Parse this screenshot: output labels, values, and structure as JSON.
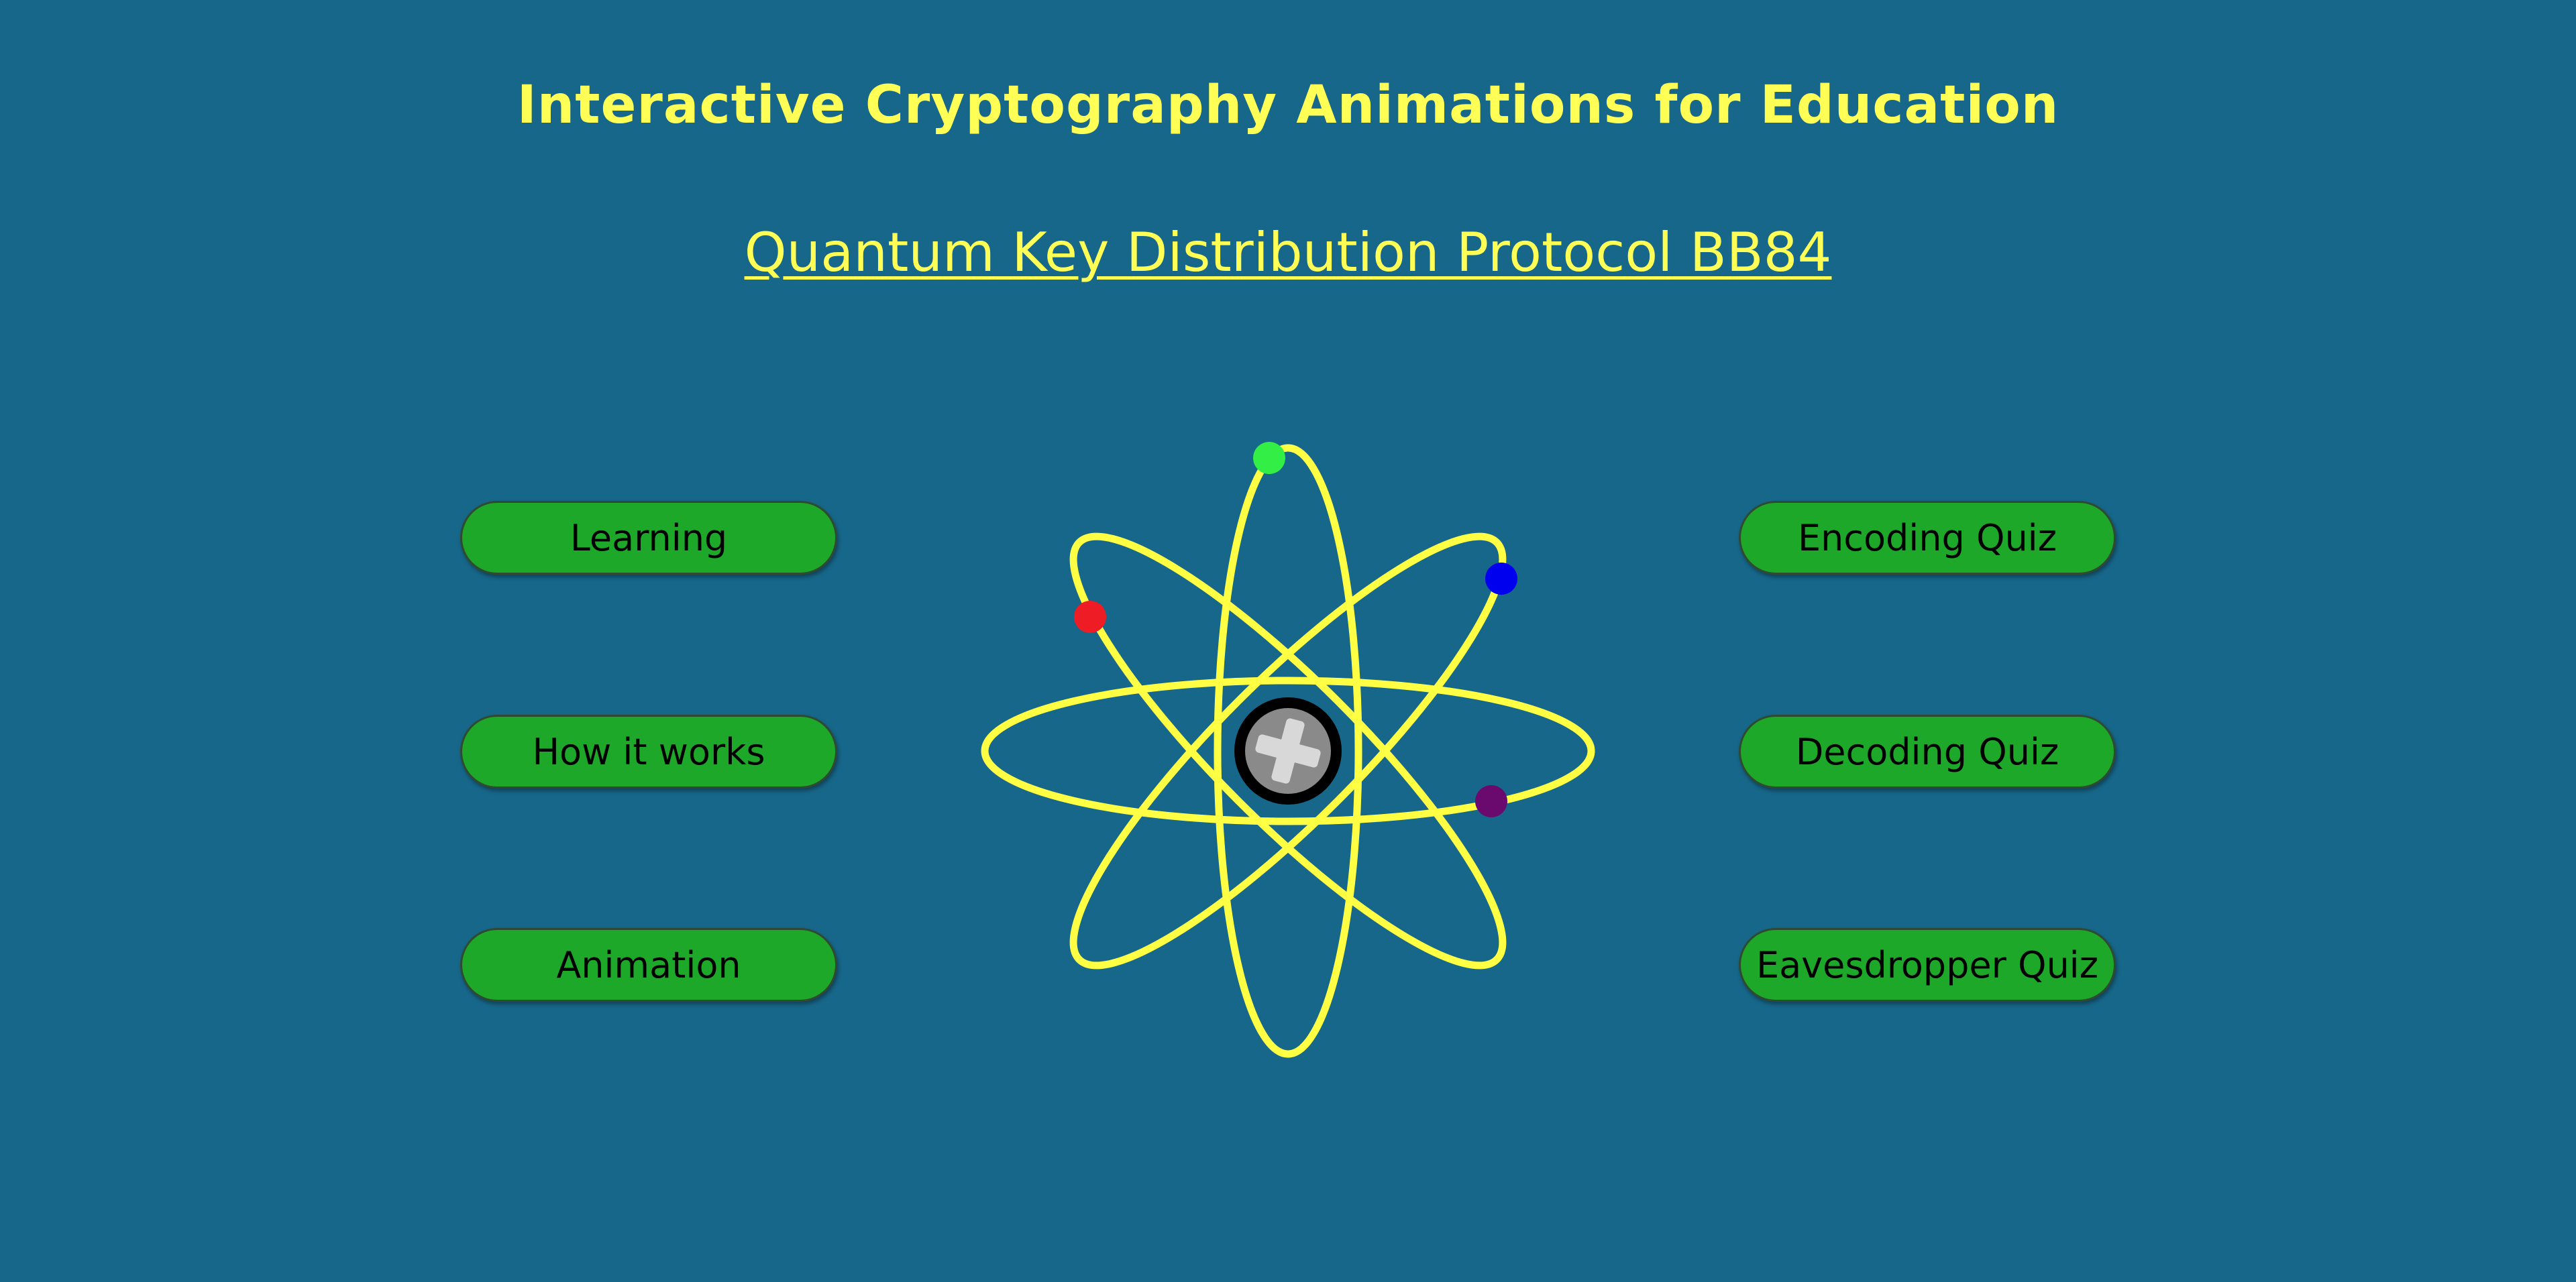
{
  "header": {
    "title": "Interactive Cryptography Animations for Education",
    "subtitle": "Quantum Key Distribution Protocol BB84"
  },
  "left_menu": [
    {
      "label": "Learning"
    },
    {
      "label": "How it works"
    },
    {
      "label": "Animation"
    }
  ],
  "right_menu": [
    {
      "label": "Encoding Quiz"
    },
    {
      "label": "Decoding Quiz"
    },
    {
      "label": "Eavesdropper Quiz"
    }
  ],
  "colors": {
    "background": "#17678a",
    "title_text": "#ffff55",
    "button_fill": "#1ea82a",
    "orbit": "#ffff44",
    "electron_green": "#33ee44",
    "electron_blue": "#0000ee",
    "electron_red": "#ee1c24",
    "electron_purple": "#6a0a6e"
  },
  "icons": {
    "atom": "atom-icon",
    "nucleus": "plus-sign-icon"
  }
}
